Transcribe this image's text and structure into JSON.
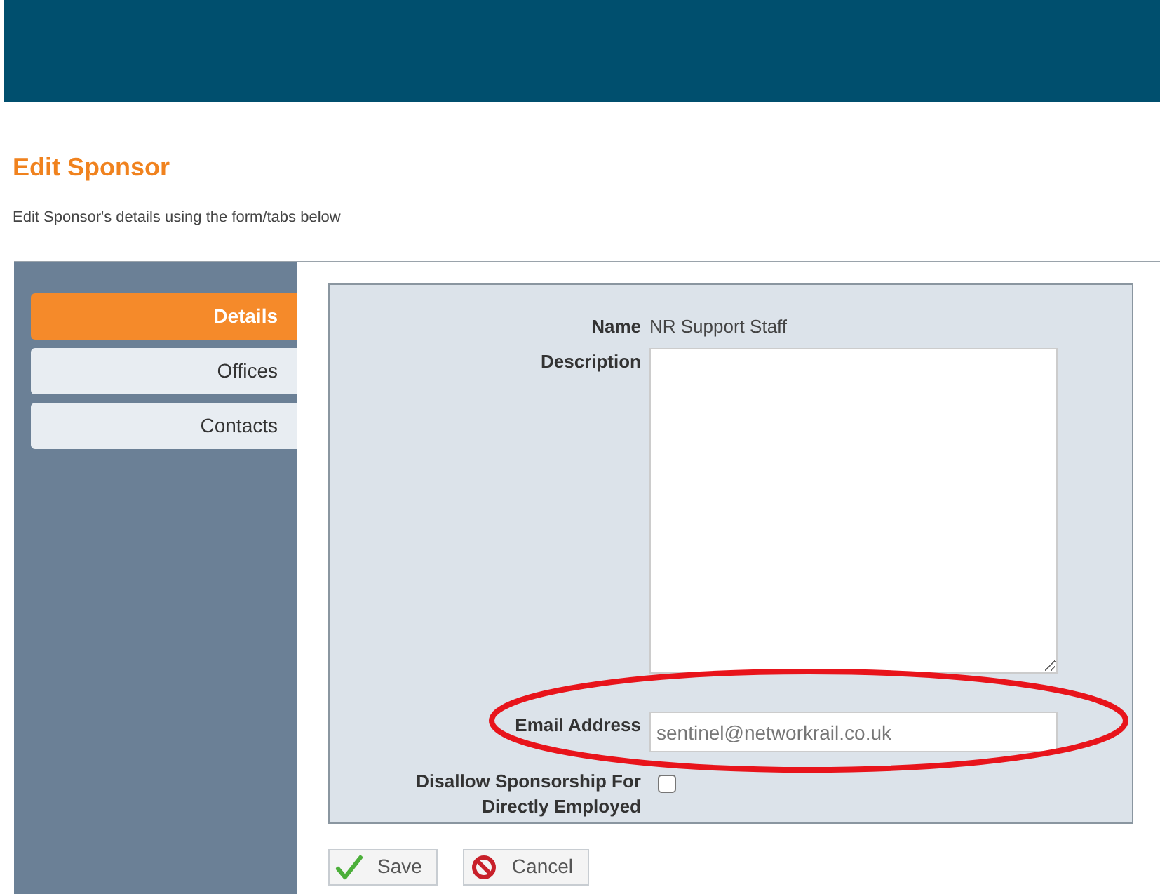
{
  "page": {
    "title": "Edit Sponsor",
    "subtitle": "Edit Sponsor's details using the form/tabs below"
  },
  "tabs": [
    {
      "label": "Details",
      "selected": true
    },
    {
      "label": "Offices",
      "selected": false
    },
    {
      "label": "Contacts",
      "selected": false
    }
  ],
  "form": {
    "fields": [
      {
        "kind": "text",
        "label": "Name",
        "value": "NR Support Staff"
      },
      {
        "kind": "textarea",
        "label": "Description"
      },
      {
        "kind": "input",
        "label": "Email Address",
        "value": "sentinel@networkrail.co.uk",
        "highlighted": true
      },
      {
        "kind": "checkbox",
        "label": "Disallow Sponsorship For Directly Employed",
        "checked": false
      }
    ]
  },
  "buttons": [
    {
      "kind": "save",
      "label": "Save"
    },
    {
      "kind": "cancel",
      "label": "Cancel"
    }
  ]
}
